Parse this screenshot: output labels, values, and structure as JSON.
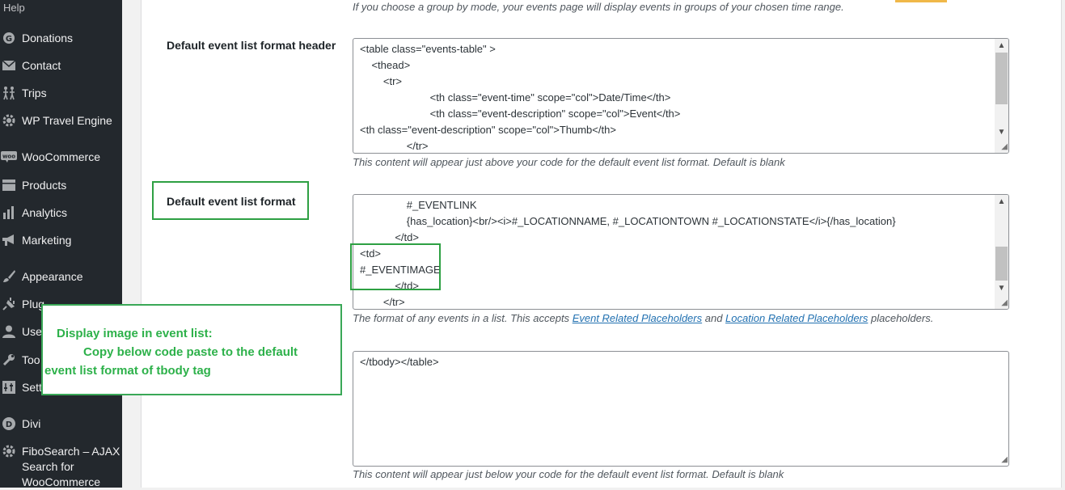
{
  "sidebar": {
    "items": [
      {
        "label": "Help",
        "icon": "help-icon"
      },
      {
        "label": "Donations",
        "icon": "donations-icon"
      },
      {
        "label": "Contact",
        "icon": "mail-icon"
      },
      {
        "label": "Trips",
        "icon": "trips-icon"
      },
      {
        "label": "WP Travel Engine",
        "icon": "gear-icon"
      },
      {
        "label": "WooCommerce",
        "icon": "woocommerce-icon"
      },
      {
        "label": "Products",
        "icon": "products-icon"
      },
      {
        "label": "Analytics",
        "icon": "analytics-icon"
      },
      {
        "label": "Marketing",
        "icon": "megaphone-icon"
      },
      {
        "label": "Appearance",
        "icon": "brush-icon"
      },
      {
        "label": "Plug",
        "icon": "plugin-icon"
      },
      {
        "label": "Use",
        "icon": "user-icon"
      },
      {
        "label": "Too",
        "icon": "wrench-icon"
      },
      {
        "label": "Sett",
        "icon": "settings-icon"
      },
      {
        "label": "Divi",
        "icon": "divi-icon"
      },
      {
        "label": "FiboSearch – AJAX",
        "label2": "Search for",
        "label3": "WooCommerce",
        "icon": "gear-icon"
      }
    ]
  },
  "top_description": "If you choose a group by mode, your events page will display events in groups of your chosen time range.",
  "header_field": {
    "label": "Default event list format header",
    "lines": [
      "<table class=\"events-table\" >",
      "    <thead>",
      "        <tr>",
      "                        <th class=\"event-time\" scope=\"col\">Date/Time</th>",
      "                        <th class=\"event-description\" scope=\"col\">Event</th>",
      "<th class=\"event-description\" scope=\"col\">Thumb</th>",
      "                </tr>"
    ],
    "description": "This content will appear just above your code for the default event list format. Default is blank"
  },
  "format_field": {
    "label": "Default event list format",
    "lines": [
      "                #_EVENTLINK",
      "                {has_location}<br/><i>#_LOCATIONNAME, #_LOCATIONTOWN #_LOCATIONSTATE</i>{/has_location}",
      "            </td>",
      "<td>",
      "#_EVENTIMAGE",
      "            </td>",
      "        </tr>"
    ],
    "description_prefix": "The format of any events in a list. This accepts ",
    "link1": "Event Related Placeholders",
    "description_mid": " and ",
    "link2": "Location Related Placeholders",
    "description_suffix": " placeholders."
  },
  "footer_field": {
    "lines": [
      "</tbody></table>"
    ],
    "description": "This content will appear just below your code for the default event list format. Default is blank"
  },
  "callout": {
    "line1": "Display image in event list:",
    "line2": "Copy below code paste to the default",
    "line3": "event list format of tbody tag"
  },
  "colors": {
    "sidebar_bg": "#23282d",
    "annotation_green": "#2db14a",
    "link": "#2271b1"
  }
}
